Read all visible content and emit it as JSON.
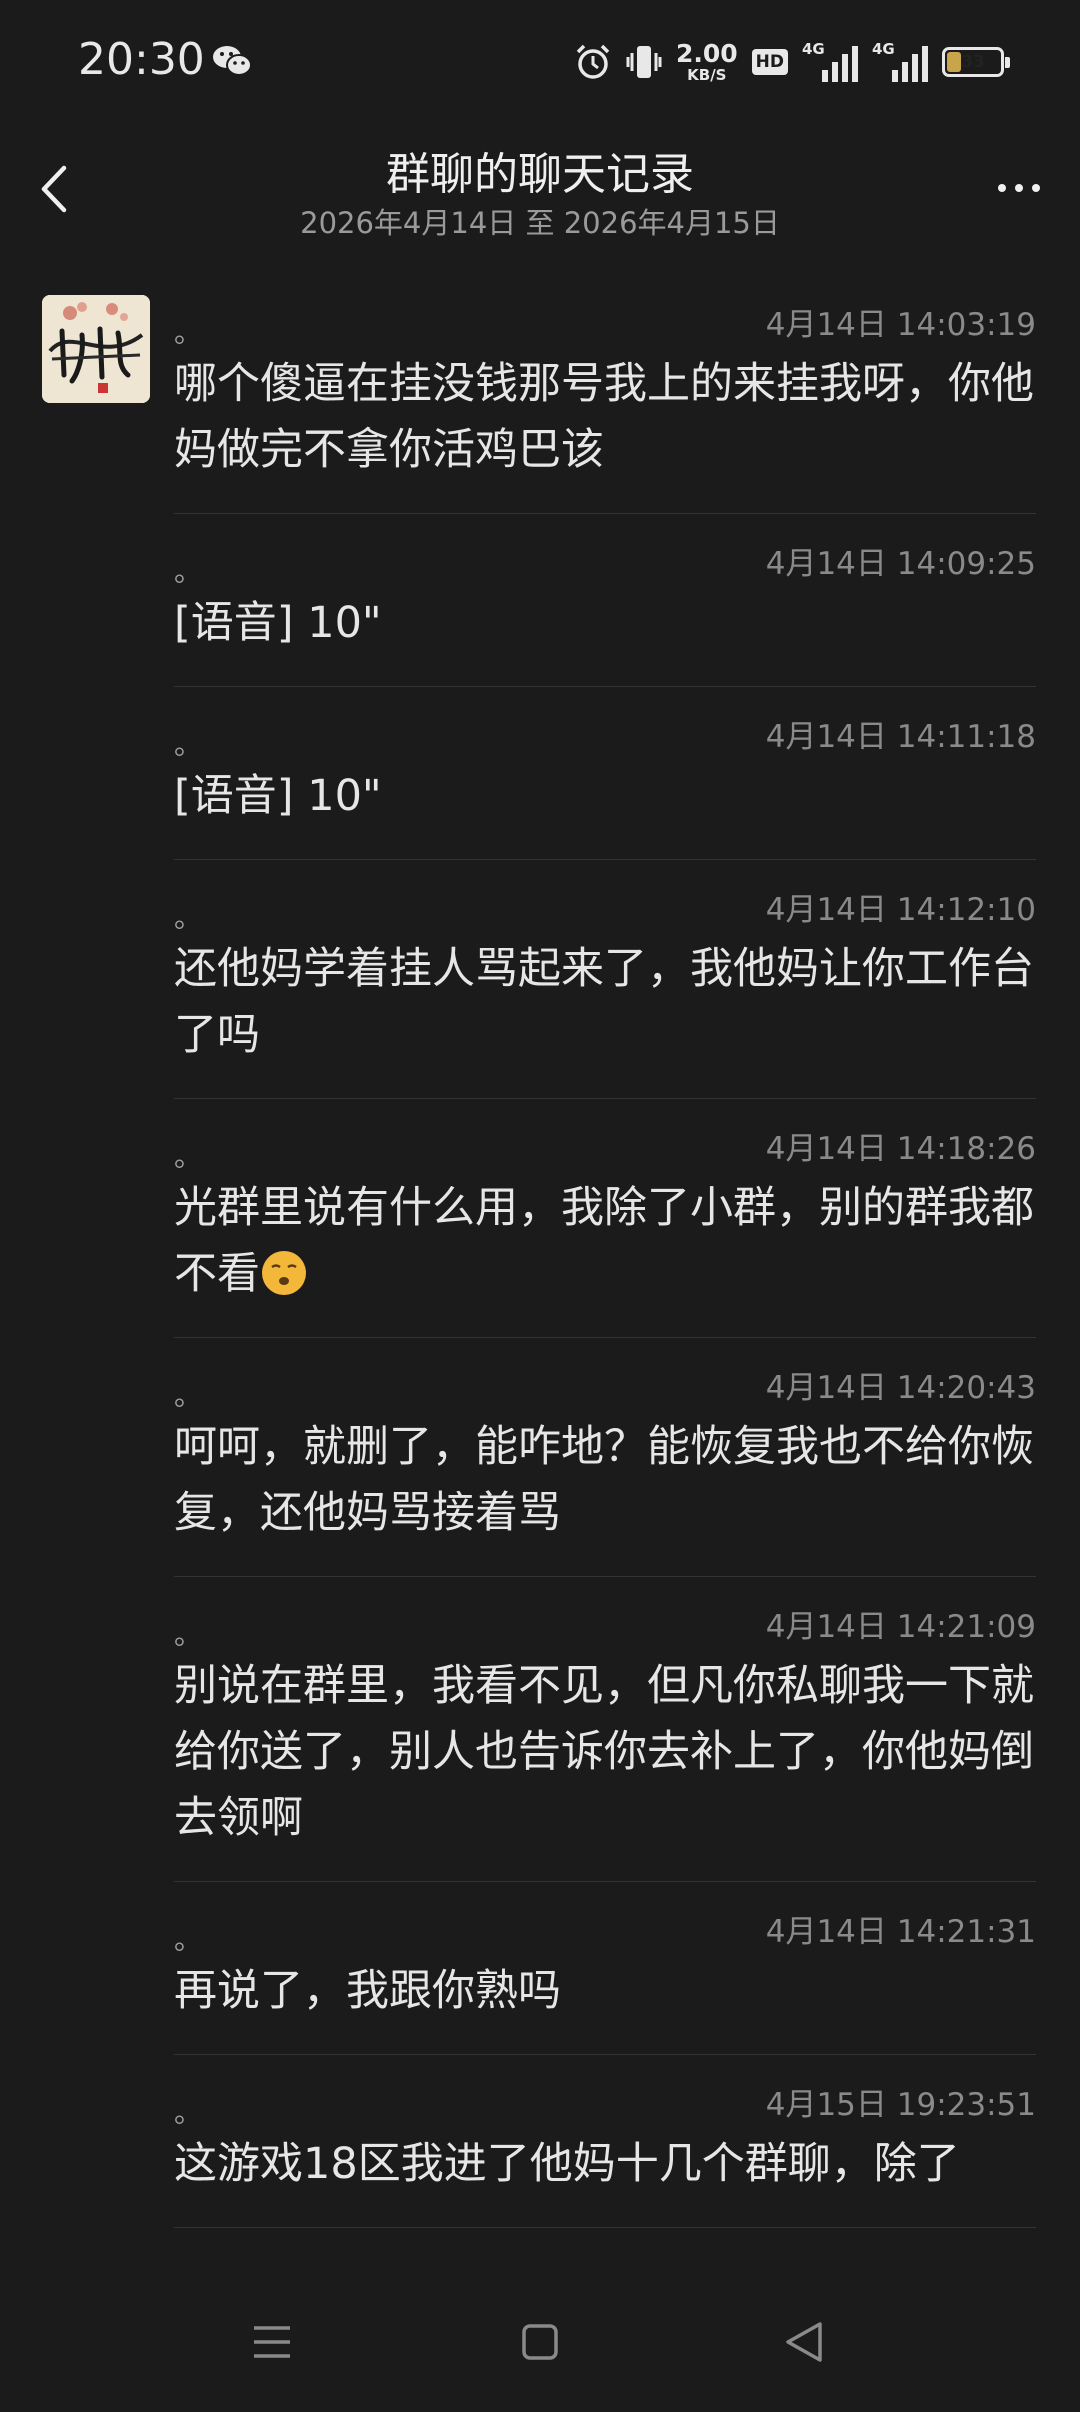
{
  "status_bar": {
    "time": "20:30",
    "net_speed_value": "2.00",
    "net_speed_unit": "KB/S",
    "hd_label": "HD",
    "signal1_label": "4G",
    "signal2_label": "4G",
    "battery_level": "33",
    "battery_fill_fraction": 0.33,
    "battery_accent_color": "#c9a44a",
    "icons": [
      "wechat-icon",
      "alarm-icon",
      "vibrate-icon",
      "signal-icon",
      "battery-icon"
    ]
  },
  "header": {
    "title": "群聊的聊天记录",
    "subtitle": "2026年4月14日 至 2026年4月15日",
    "back_icon": "chevron-left-icon",
    "more_icon": "more-dots-icon"
  },
  "messages": [
    {
      "sender": "。",
      "time": "4月14日 14:03:19",
      "text": "哪个傻逼在挂没钱那号我上的来挂我呀，你他妈做完不拿你活鸡巴该"
    },
    {
      "sender": "。",
      "time": "4月14日 14:09:25",
      "text": "[语音] 10\""
    },
    {
      "sender": "。",
      "time": "4月14日 14:11:18",
      "text": "[语音] 10\""
    },
    {
      "sender": "。",
      "time": "4月14日 14:12:10",
      "text": "还他妈学着挂人骂起来了，我他妈让你工作台了吗"
    },
    {
      "sender": "。",
      "time": "4月14日 14:18:26",
      "text": "光群里说有什么用，我除了小群，别的群我都不看"
    },
    {
      "sender": "。",
      "time": "4月14日 14:20:43",
      "text": "呵呵，就删了，能咋地？能恢复我也不给你恢复，还他妈骂接着骂"
    },
    {
      "sender": "。",
      "time": "4月14日 14:21:09",
      "text": "别说在群里，我看不见，但凡你私聊我一下就给你送了，别人也告诉你去补上了，你他妈倒去领啊"
    },
    {
      "sender": "。",
      "time": "4月14日 14:21:31",
      "text": "再说了，我跟你熟吗"
    },
    {
      "sender": "。",
      "time": "4月15日 19:23:51",
      "text": "这游戏18区我进了他妈十几个群聊，除了"
    }
  ],
  "navbar": {
    "icons": [
      "menu-icon",
      "home-icon",
      "back-triangle-icon"
    ]
  }
}
